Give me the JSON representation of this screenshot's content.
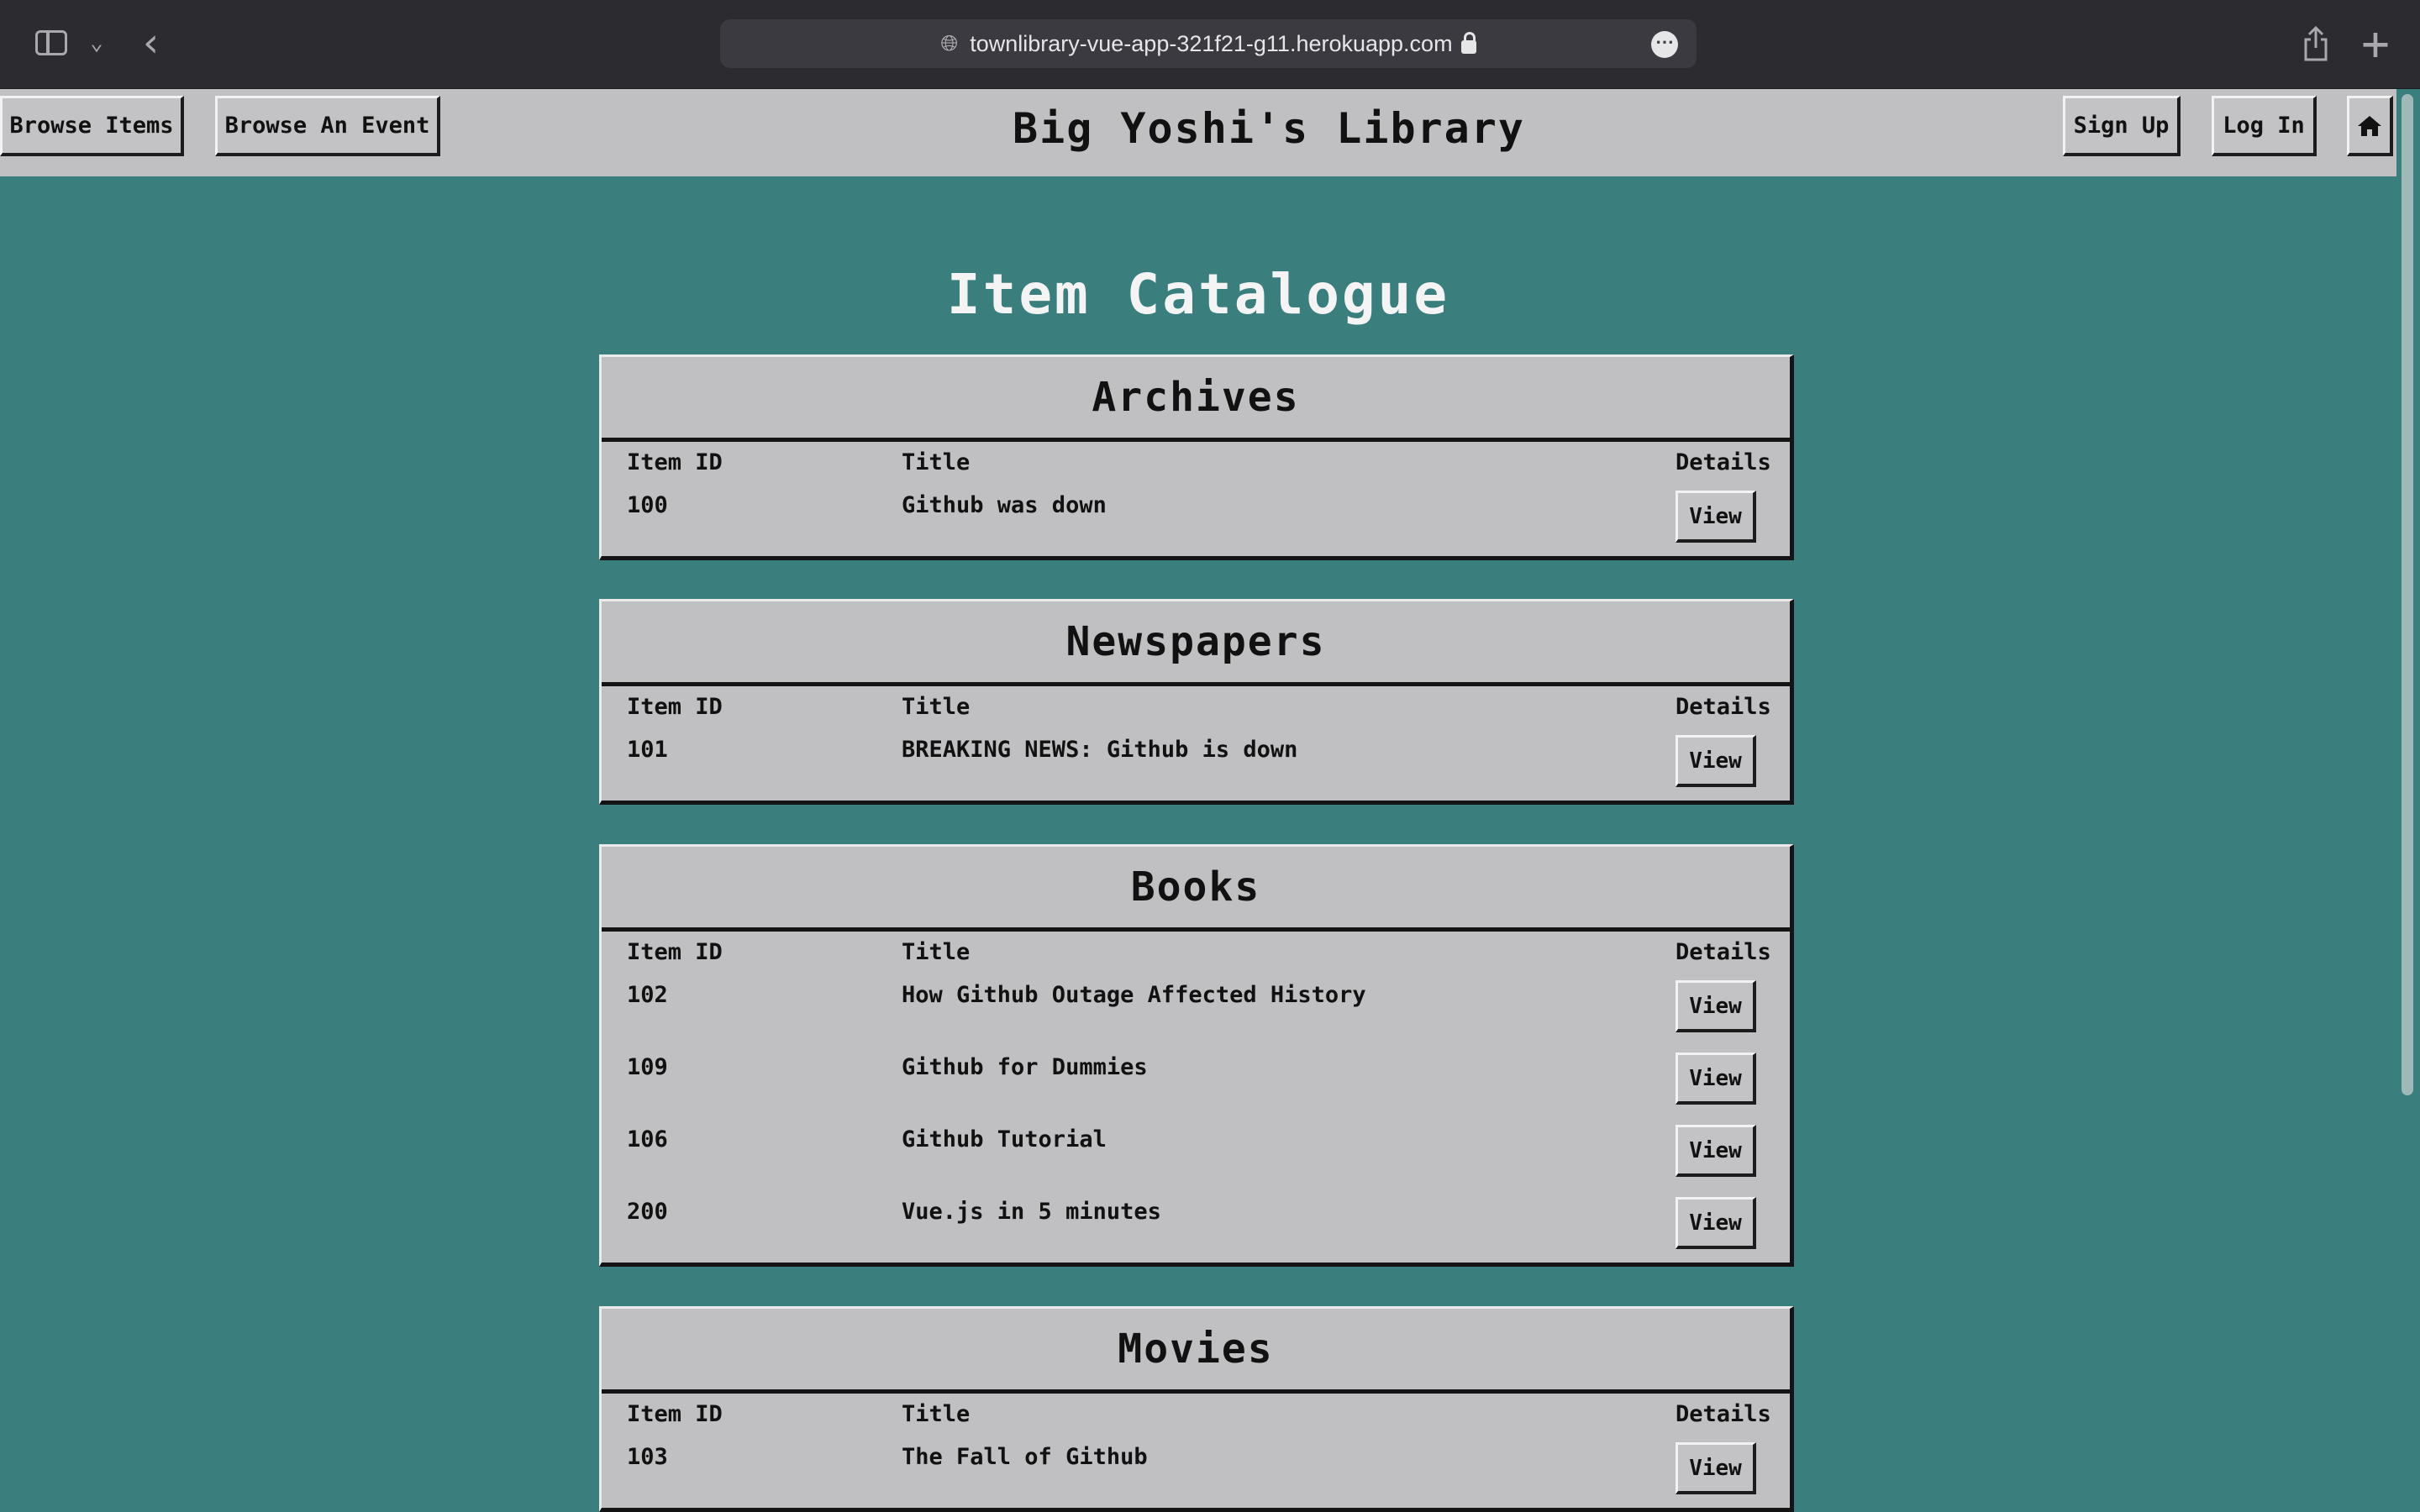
{
  "browser": {
    "url": "townlibrary-vue-app-321f21-g11.herokuapp.com",
    "icons": [
      "sidebar-icon",
      "chevron-down-icon",
      "back-icon",
      "globe-icon",
      "lock-icon",
      "more-icon",
      "share-icon",
      "plus-icon"
    ]
  },
  "nav": {
    "browse_items": "Browse Items",
    "browse_event": "Browse An Event",
    "site_title": "Big Yoshi's Library",
    "sign_up": "Sign Up",
    "log_in": "Log In",
    "home_icon": "home-icon"
  },
  "page": {
    "heading": "Item Catalogue",
    "columns": {
      "id": "Item ID",
      "title": "Title",
      "details": "Details"
    },
    "view_label": "View",
    "categories": [
      {
        "name": "Archives",
        "items": [
          {
            "id": "100",
            "title": "Github was down"
          }
        ]
      },
      {
        "name": "Newspapers",
        "items": [
          {
            "id": "101",
            "title": "BREAKING NEWS: Github is down"
          }
        ]
      },
      {
        "name": "Books",
        "items": [
          {
            "id": "102",
            "title": "How Github Outage Affected History"
          },
          {
            "id": "109",
            "title": "Github for Dummies"
          },
          {
            "id": "106",
            "title": "Github Tutorial"
          },
          {
            "id": "200",
            "title": "Vue.js in 5 minutes"
          }
        ]
      },
      {
        "name": "Movies",
        "items": [
          {
            "id": "103",
            "title": "The Fall of Github"
          }
        ]
      }
    ]
  },
  "colors": {
    "page_background": "#3a7e7e",
    "panel": "#c0c0c2",
    "chrome": "#2c2b30"
  }
}
